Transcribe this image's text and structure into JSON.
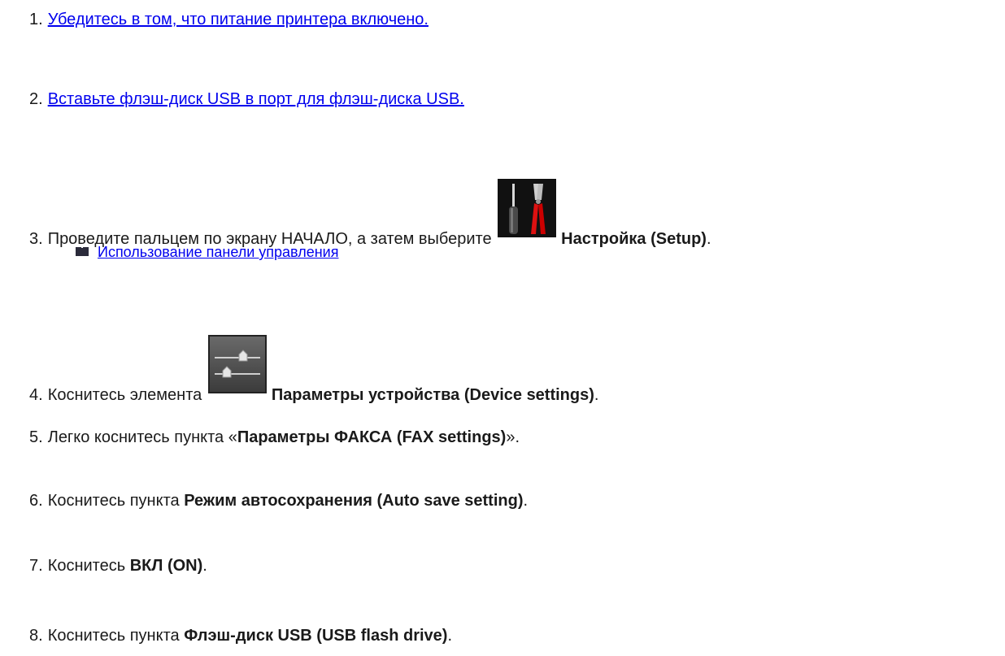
{
  "steps": [
    {
      "num": "1.",
      "link": "Убедитесь в том, что питание принтера включено."
    },
    {
      "num": "2.",
      "link": "Вставьте флэш-диск USB в порт для флэш-диска USB."
    },
    {
      "num": "3.",
      "text_before": "Проведите пальцем по экрану НАЧАЛО, а затем выберите",
      "icon": "setup-tools-icon",
      "bold": "Настройка (Setup)",
      "text_after": "."
    },
    {
      "num": "4.",
      "text_before": "Коснитесь элемента",
      "icon": "device-settings-sliders-icon",
      "bold": "Параметры устройства (Device settings)",
      "text_after": "."
    },
    {
      "num": "5.",
      "text_before": "Легко коснитесь пункта «",
      "bold": "Параметры ФАКСА (FAX settings)",
      "text_after": "»."
    },
    {
      "num": "6.",
      "text_before": "Коснитесь пункта",
      "bold": "Режим автосохранения (Auto save setting)",
      "text_after": "."
    },
    {
      "num": "7.",
      "text_before": "Коснитесь",
      "bold": "ВКЛ (ON)",
      "text_after": "."
    },
    {
      "num": "8.",
      "text_before": "Коснитесь пункта",
      "bold": "Флэш-диск USB (USB flash drive)",
      "text_after": "."
    }
  ],
  "sublink": {
    "icon": "book-icon",
    "label": "Использование панели управления"
  },
  "colors": {
    "link": "#0000ee",
    "text": "#1a1a1a"
  }
}
